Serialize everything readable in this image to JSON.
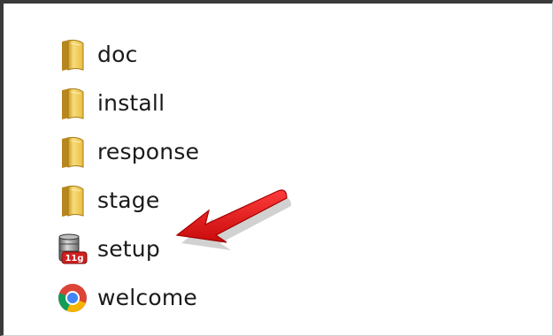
{
  "files": [
    {
      "label": "doc",
      "icon": "folder-icon"
    },
    {
      "label": "install",
      "icon": "folder-icon"
    },
    {
      "label": "response",
      "icon": "folder-icon"
    },
    {
      "label": "stage",
      "icon": "folder-icon"
    },
    {
      "label": "setup",
      "icon": "oracle-setup-icon",
      "icon_badge": "11g"
    },
    {
      "label": "welcome",
      "icon": "chrome-html-icon"
    }
  ],
  "annotation": {
    "icon": "red-arrow-icon",
    "points_to": "setup",
    "color": "#e01212"
  },
  "colors": {
    "folder": "#f0c94a",
    "arrow": "#e01212",
    "text": "#1a1a1a"
  }
}
